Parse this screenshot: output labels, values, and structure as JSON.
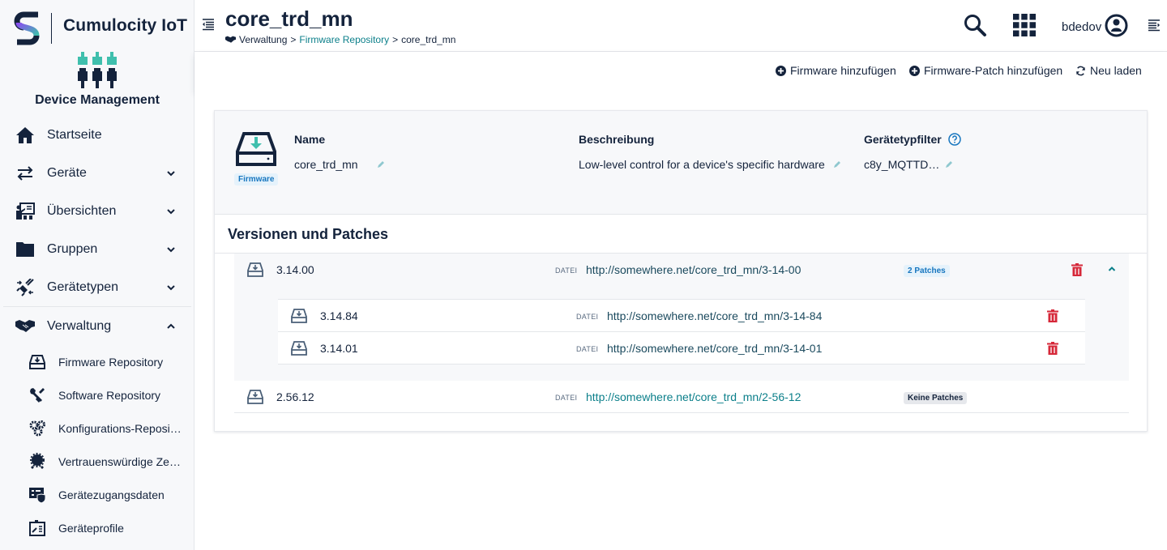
{
  "brand": {
    "name": "Cumulocity IoT",
    "app_name": "Device Management"
  },
  "sidebar": {
    "items": [
      {
        "label": "Startseite",
        "icon": "home-icon",
        "expandable": false
      },
      {
        "label": "Geräte",
        "icon": "exchange-arrows-icon",
        "expandable": true,
        "expanded": false
      },
      {
        "label": "Übersichten",
        "icon": "presentation-icon",
        "expandable": true,
        "expanded": false
      },
      {
        "label": "Gruppen",
        "icon": "folder-icon",
        "expandable": true,
        "expanded": false
      },
      {
        "label": "Gerätetypen",
        "icon": "plug-icon",
        "expandable": true,
        "expanded": false
      },
      {
        "label": "Verwaltung",
        "icon": "handshake-icon",
        "expandable": true,
        "expanded": true
      }
    ],
    "sub_items": [
      {
        "label": "Firmware Repository",
        "icon": "firmware-drive-icon"
      },
      {
        "label": "Software Repository",
        "icon": "tools-icon"
      },
      {
        "label": "Konfigurations-Reposi…",
        "icon": "cogs-icon"
      },
      {
        "label": "Vertrauenswürdige Ze…",
        "icon": "certificate-icon"
      },
      {
        "label": "Gerätezugangsdaten",
        "icon": "device-shield-icon"
      },
      {
        "label": "Geräteprofile",
        "icon": "device-profile-icon"
      }
    ]
  },
  "header": {
    "title": "core_trd_mn",
    "breadcrumb": [
      "Verwaltung",
      "Firmware Repository",
      "core_trd_mn"
    ],
    "breadcrumb_separator": ">",
    "user": "bdedov"
  },
  "actions": {
    "add_firmware": "Firmware hinzufügen",
    "add_patch": "Firmware-Patch hinzufügen",
    "reload": "Neu laden"
  },
  "firmware": {
    "badge": "Firmware",
    "name_label": "Name",
    "name_value": "core_trd_mn",
    "description_label": "Beschreibung",
    "description_value": "Low-level control for a device's specific hardware",
    "filter_label": "Gerätetypfilter",
    "filter_value": "c8y_MQTTD…"
  },
  "versions": {
    "title": "Versionen und Patches",
    "file_label": "DATEI",
    "items": [
      {
        "version": "3.14.00",
        "url": "http://somewhere.net/core_trd_mn/3-14-00",
        "patch_badge": "2 Patches",
        "expanded": true,
        "patches": [
          {
            "version": "3.14.84",
            "url": "http://somewhere.net/core_trd_mn/3-14-84"
          },
          {
            "version": "3.14.01",
            "url": "http://somewhere.net/core_trd_mn/3-14-01"
          }
        ]
      },
      {
        "version": "2.56.12",
        "url": "http://somewhere.net/core_trd_mn/2-56-12",
        "patch_badge": "Keine Patches",
        "expanded": false,
        "patches": []
      }
    ]
  },
  "colors": {
    "primary_text": "#14233c",
    "link_teal": "#0b7f8a",
    "accent_teal": "#3fbfad",
    "danger_red": "#d62839",
    "info_blue": "#1776bf"
  }
}
